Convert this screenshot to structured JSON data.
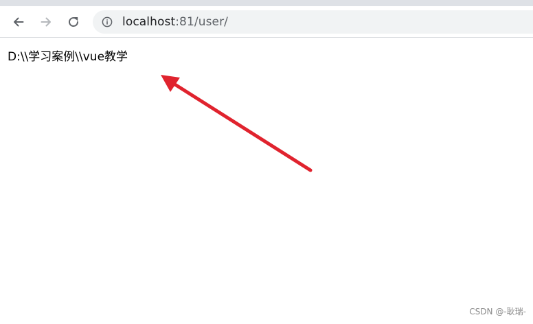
{
  "browser": {
    "url_host": "localhost",
    "url_rest": ":81/user/",
    "icons": {
      "back": "arrow-left-icon",
      "forward": "arrow-right-icon",
      "reload": "reload-icon",
      "site_info": "info-circle-icon"
    }
  },
  "page": {
    "content_text": "D:\\\\学习案例\\\\vue教学"
  },
  "annotation": {
    "color": "#e0232e"
  },
  "watermark": {
    "text": "CSDN @-耿瑞-"
  }
}
